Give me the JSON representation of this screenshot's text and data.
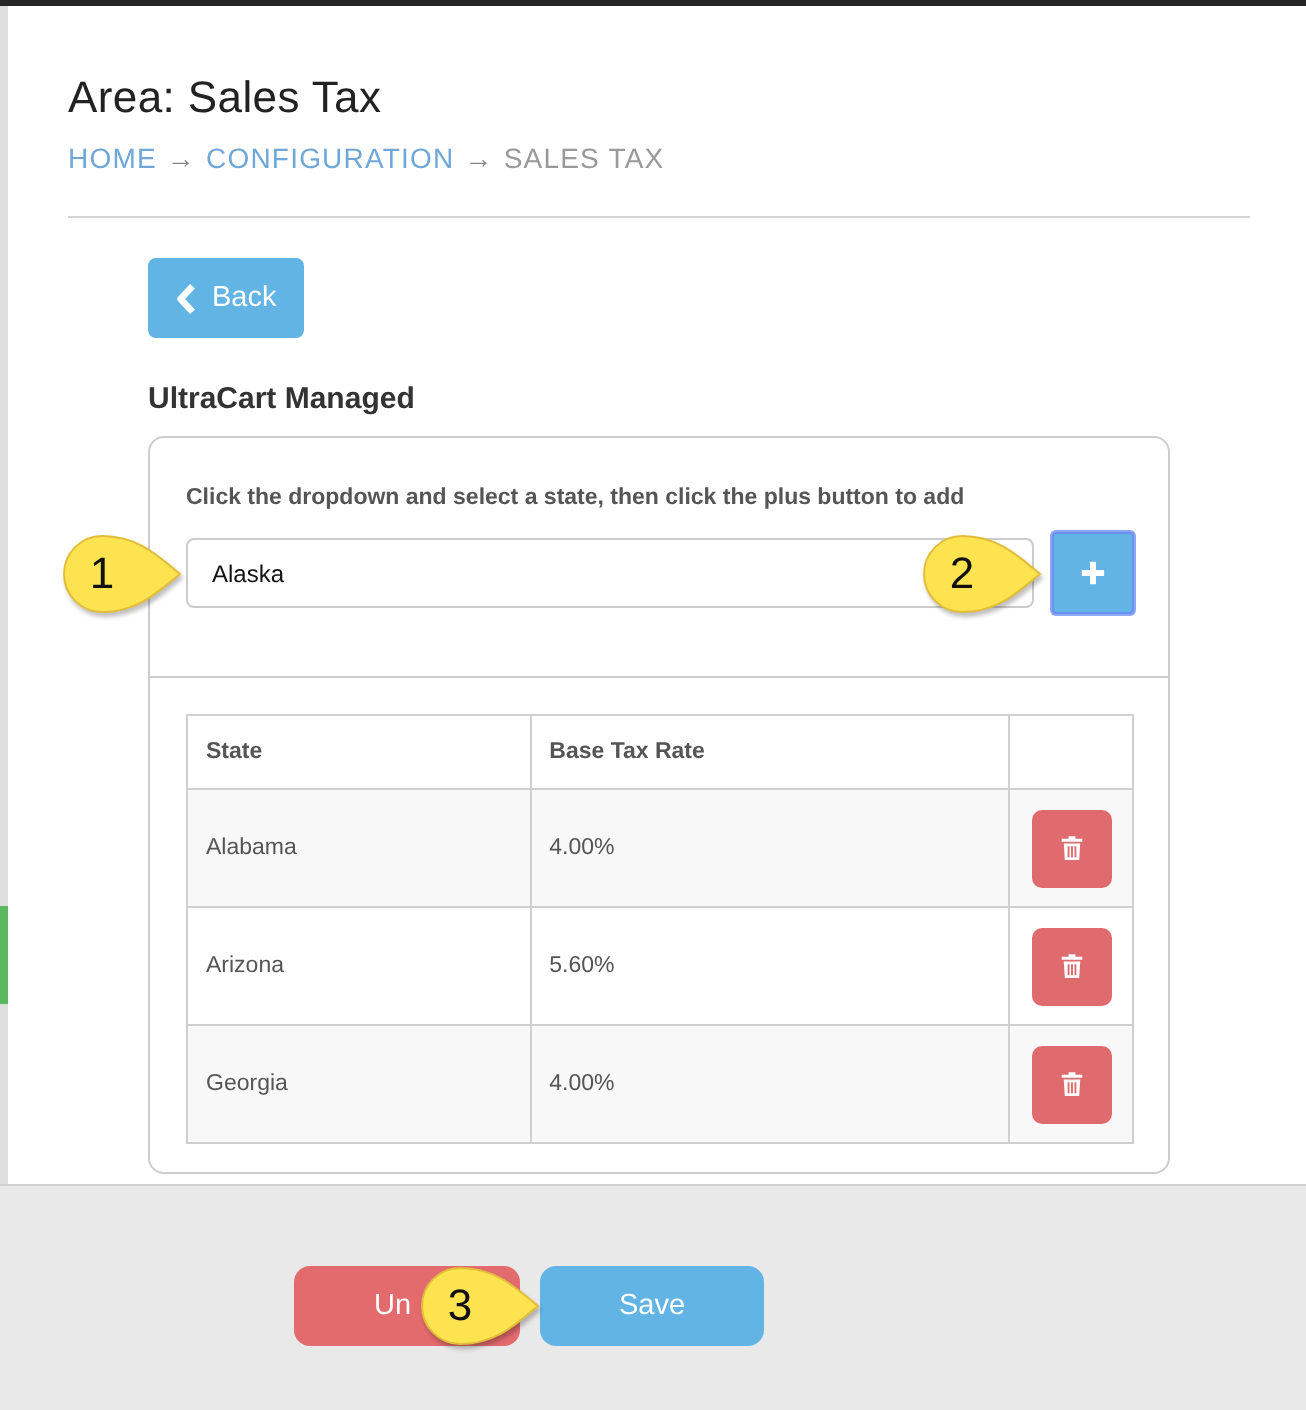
{
  "page": {
    "title": "Area: Sales Tax",
    "breadcrumb": [
      {
        "kind": "link",
        "label": "HOME"
      },
      {
        "kind": "separator",
        "label": "→"
      },
      {
        "kind": "link",
        "label": "CONFIGURATION"
      },
      {
        "kind": "separator",
        "label": "→"
      },
      {
        "kind": "current",
        "label": "SALES TAX"
      }
    ]
  },
  "back_button": {
    "label": "Back"
  },
  "section_title": "UltraCart Managed",
  "card": {
    "instruction": "Click the dropdown and select a state, then click the plus button to add",
    "state_select": {
      "value": "Alaska"
    },
    "add_button": {
      "focused": true
    },
    "table": {
      "columns": [
        "State",
        "Base Tax Rate"
      ],
      "rows": [
        {
          "state": "Alabama",
          "rate": "4.00%"
        },
        {
          "state": "Arizona",
          "rate": "5.60%"
        },
        {
          "state": "Georgia",
          "rate": "4.00%"
        }
      ]
    }
  },
  "footer_buttons": [
    {
      "kind": "danger",
      "label": "Un"
    },
    {
      "kind": "primary",
      "label": "Save"
    }
  ],
  "callouts": [
    {
      "label": "1"
    },
    {
      "label": "2"
    },
    {
      "label": "3"
    }
  ]
}
